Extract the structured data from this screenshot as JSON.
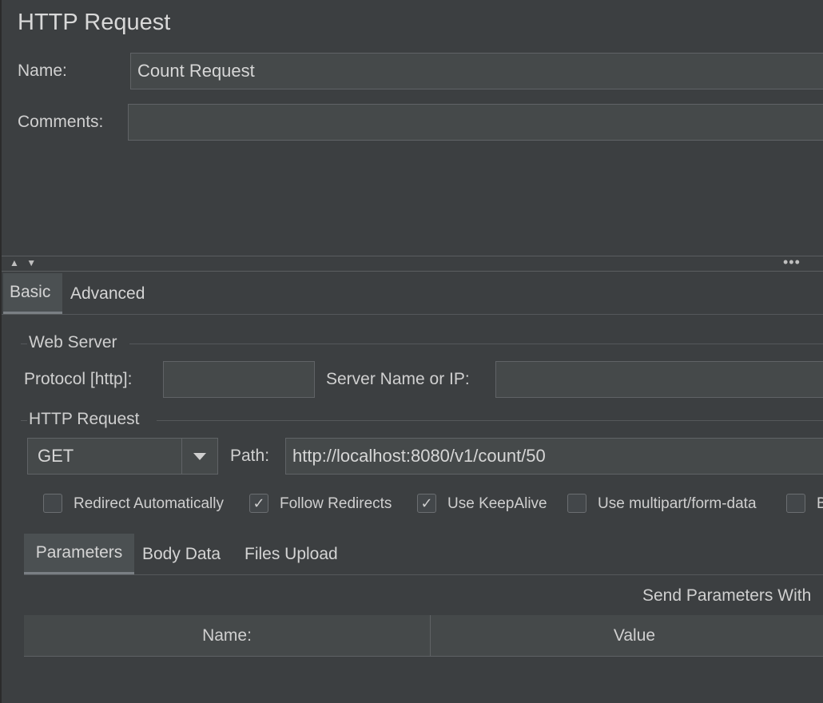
{
  "panel": {
    "title": "HTTP Request",
    "name_label": "Name:",
    "name_value": "Count Request",
    "comments_label": "Comments:",
    "comments_value": ""
  },
  "main_tabs": [
    {
      "label": "Basic",
      "active": true
    },
    {
      "label": "Advanced",
      "active": false
    }
  ],
  "web_server": {
    "group_title": "Web Server",
    "protocol_label": "Protocol [http]:",
    "protocol_value": "",
    "server_label": "Server Name or IP:",
    "server_value": ""
  },
  "http_request": {
    "group_title": "HTTP Request",
    "method": "GET",
    "path_label": "Path:",
    "path_value": "http://localhost:8080/v1/count/50"
  },
  "options": [
    {
      "label": "Redirect Automatically",
      "checked": false
    },
    {
      "label": "Follow Redirects",
      "checked": true
    },
    {
      "label": "Use KeepAlive",
      "checked": true
    },
    {
      "label": "Use multipart/form-data",
      "checked": false
    },
    {
      "label": "B",
      "checked": false
    }
  ],
  "param_tabs": [
    {
      "label": "Parameters",
      "active": true
    },
    {
      "label": "Body Data",
      "active": false
    },
    {
      "label": "Files Upload",
      "active": false
    }
  ],
  "parameters": {
    "send_label": "Send Parameters With",
    "columns": [
      "Name:",
      "Value"
    ]
  },
  "icons": {
    "collapse": "▲ ▼",
    "more": "•••",
    "check": "✓"
  }
}
